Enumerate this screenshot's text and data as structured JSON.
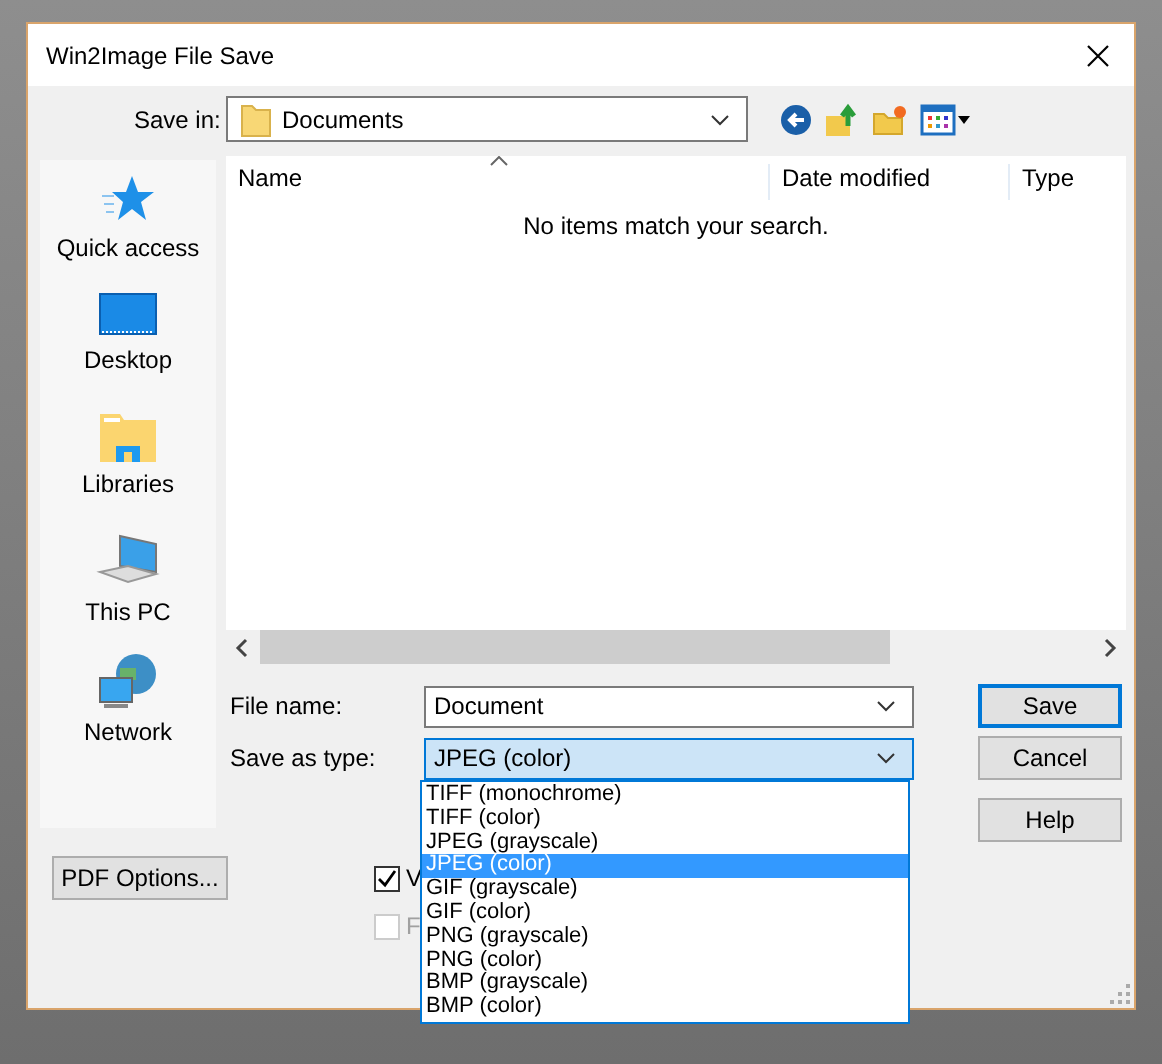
{
  "window": {
    "title": "Win2Image File Save"
  },
  "save_in": {
    "label": "Save in:",
    "value": "Documents"
  },
  "places": [
    {
      "kind": "star",
      "label": "Quick access"
    },
    {
      "kind": "desktop",
      "label": "Desktop"
    },
    {
      "kind": "libraries",
      "label": "Libraries"
    },
    {
      "kind": "computer",
      "label": "This PC"
    },
    {
      "kind": "network",
      "label": "Network"
    }
  ],
  "file_list": {
    "columns": [
      "Name",
      "Date modified",
      "Type"
    ],
    "empty_message": "No items match your search."
  },
  "file_name": {
    "label": "File name:",
    "value": "Document"
  },
  "save_as_type": {
    "label": "Save as type:",
    "value": "JPEG (color)",
    "expanded": true,
    "options": [
      {
        "label": "TIFF (monochrome)",
        "selected": false
      },
      {
        "label": "TIFF (color)",
        "selected": false
      },
      {
        "label": "JPEG (grayscale)",
        "selected": false
      },
      {
        "label": "JPEG (color)",
        "selected": true
      },
      {
        "label": "GIF (grayscale)",
        "selected": false
      },
      {
        "label": "GIF (color)",
        "selected": false
      },
      {
        "label": "PNG (grayscale)",
        "selected": false
      },
      {
        "label": "PNG (color)",
        "selected": false
      },
      {
        "label": "BMP (grayscale)",
        "selected": false
      },
      {
        "label": "BMP (color)",
        "selected": false
      }
    ]
  },
  "buttons": [
    {
      "label": "Save",
      "default": true
    },
    {
      "label": "Cancel",
      "default": false
    },
    {
      "label": "Help",
      "default": false
    }
  ],
  "pdf_options": {
    "label": "PDF Options..."
  },
  "checkboxes": [
    {
      "label": "V",
      "checked": true,
      "disabled": false
    },
    {
      "label": "F",
      "checked": false,
      "disabled": true
    }
  ]
}
